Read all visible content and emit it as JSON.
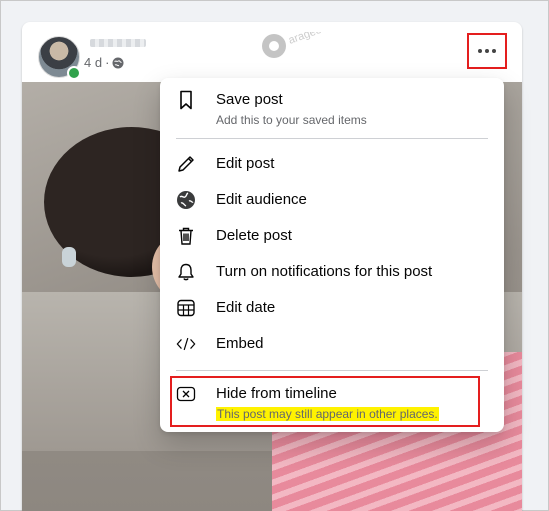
{
  "post": {
    "time": "4 d",
    "separator": "·",
    "watermark_text": "arageek"
  },
  "icons": {
    "avatar": "profile-photo",
    "privacy": "globe-icon",
    "more": "more-horizontal-icon"
  },
  "menu": {
    "items": [
      {
        "icon": "bookmark-icon",
        "label": "Save post",
        "sub": "Add this to your saved items"
      },
      {
        "icon": "pencil-icon",
        "label": "Edit post"
      },
      {
        "icon": "globe-icon",
        "label": "Edit audience"
      },
      {
        "icon": "trash-icon",
        "label": "Delete post"
      },
      {
        "icon": "bell-icon",
        "label": "Turn on notifications for this post"
      },
      {
        "icon": "calendar-icon",
        "label": "Edit date"
      },
      {
        "icon": "code-icon",
        "label": "Embed"
      },
      {
        "icon": "close-box-icon",
        "label": "Hide from timeline",
        "sub": "This post may still appear in other places."
      }
    ]
  },
  "colors": {
    "highlight_box": "#e41e1e",
    "text_highlight": "#fff200",
    "online": "#31a24c"
  }
}
